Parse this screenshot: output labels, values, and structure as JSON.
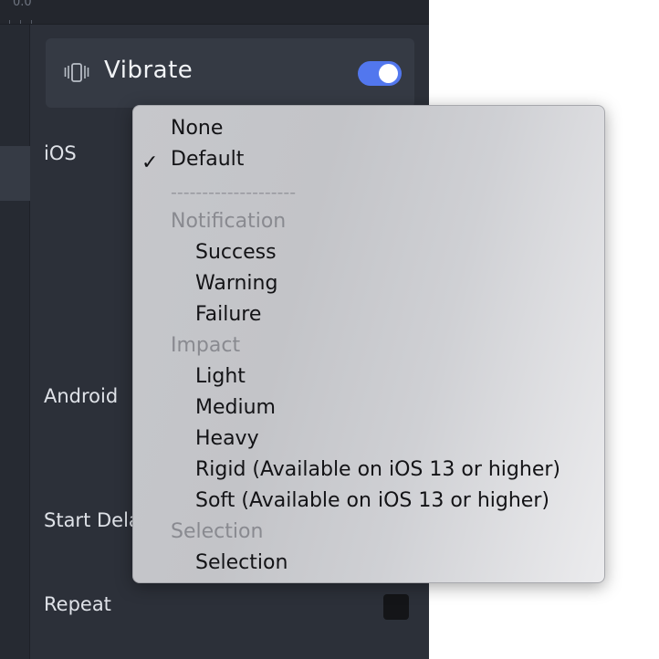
{
  "ruler": {
    "label": "0.0"
  },
  "vibrate": {
    "title": "Vibrate",
    "enabled": true,
    "icon": "vibrate-phone-icon"
  },
  "properties": {
    "ios_label": "iOS",
    "android_label": "Android",
    "start_delay_label": "Start Delay",
    "repeat_label": "Repeat"
  },
  "menu": {
    "none": "None",
    "default": "Default",
    "checkmark": "✓",
    "separator": "--------------------",
    "notification_header": "Notification",
    "success": "Success",
    "warning": "Warning",
    "failure": "Failure",
    "impact_header": "Impact",
    "light": "Light",
    "medium": "Medium",
    "heavy": "Heavy",
    "rigid": "Rigid (Available on iOS 13 or higher)",
    "soft": "Soft (Available on iOS 13 or higher)",
    "selection_header": "Selection",
    "selection": "Selection",
    "selected_item": "Default"
  },
  "colors": {
    "panel_bg": "#2c3039",
    "card_bg": "#353a44",
    "toggle_on": "#5277ee",
    "menu_header": "#898a90"
  }
}
